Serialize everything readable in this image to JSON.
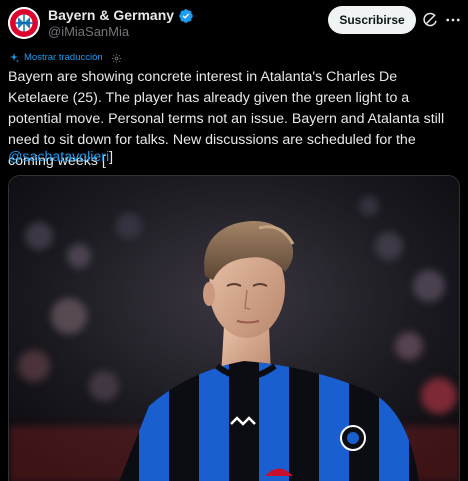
{
  "header": {
    "display_name": "Bayern & Germany",
    "handle": "@iMiaSanMia",
    "verified": true,
    "subscribe_label": "Suscribirse",
    "avatar_icon": "bayern-crest-icon",
    "grok_icon": "grok-icon",
    "more_icon": "more-options-icon"
  },
  "translation": {
    "label": "Mostrar traducción",
    "icon": "translate-sparkle-icon",
    "settings_icon": "gear-icon"
  },
  "tweet": {
    "text": "Bayern are showing concrete interest in Atalanta's Charles De Ketelaere (25). The player has already given the green light to a potential move. Personal terms not an issue. Bayern and Atalanta still need to sit down for talks. New discussions are scheduled for the coming weeks [",
    "mention": "@sachatavolieri",
    "closing": "]"
  },
  "media": {
    "type": "photo",
    "kit_colors": {
      "blue": "#1a5fcf",
      "black": "#0b0d12"
    }
  },
  "colors": {
    "background": "#000000",
    "text": "#e7e9ea",
    "muted": "#71767b",
    "accent": "#1d9bf0",
    "button_bg": "#eff3f4"
  }
}
